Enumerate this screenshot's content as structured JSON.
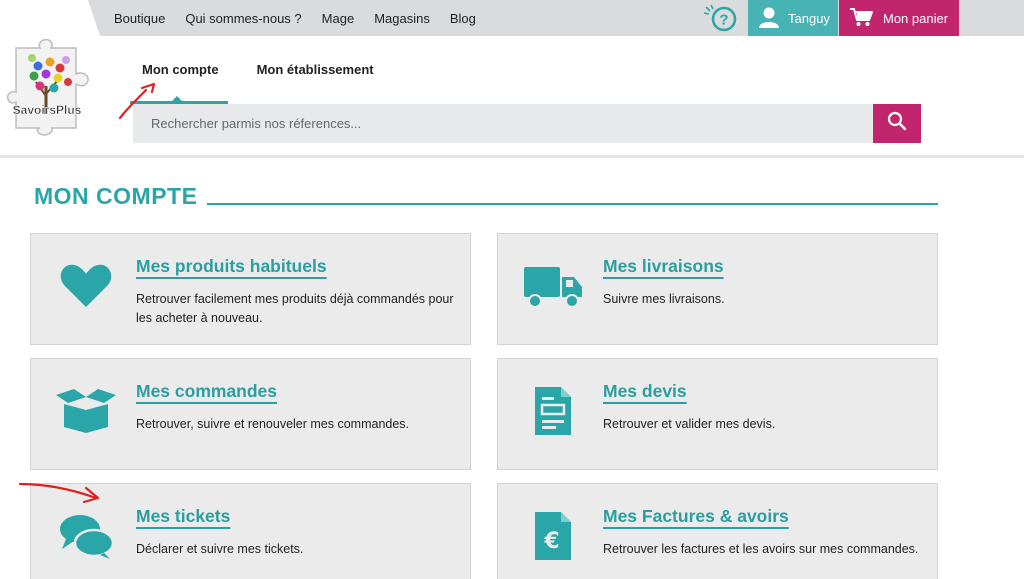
{
  "topnav": {
    "items": [
      "Boutique",
      "Qui sommes-nous ?",
      "Mage",
      "Magasins",
      "Blog"
    ]
  },
  "user": {
    "name": "Tanguy"
  },
  "cart": {
    "label": "Mon panier"
  },
  "logo": {
    "text": "SavoirsPlus"
  },
  "tabs": [
    {
      "label": "Mon compte",
      "active": true
    },
    {
      "label": "Mon établissement",
      "active": false
    }
  ],
  "search": {
    "placeholder": "Rechercher parmis nos réferences..."
  },
  "section": {
    "title": "MON COMPTE"
  },
  "cards": [
    {
      "title": "Mes produits habituels",
      "desc": "Retrouver facilement mes produits déjà commandés pour les acheter à nouveau.",
      "icon": "heart-icon"
    },
    {
      "title": "Mes livraisons",
      "desc": "Suivre mes livraisons.",
      "icon": "truck-icon"
    },
    {
      "title": "Mes commandes",
      "desc": "Retrouver, suivre et renouveler mes commandes.",
      "icon": "open-box-icon"
    },
    {
      "title": "Mes devis",
      "desc": "Retrouver et valider mes devis.",
      "icon": "document-icon"
    },
    {
      "title": "Mes tickets",
      "desc": "Déclarer et suivre mes tickets.",
      "icon": "chat-bubbles-icon"
    },
    {
      "title": "Mes Factures & avoirs",
      "desc": "Retrouver les factures et les avoirs sur mes commandes.",
      "icon": "euro-document-icon"
    }
  ],
  "colors": {
    "teal": "#2aa5a8",
    "magenta": "#c0256e",
    "user_teal": "#48b3b5",
    "annotation_red": "#e02020"
  }
}
